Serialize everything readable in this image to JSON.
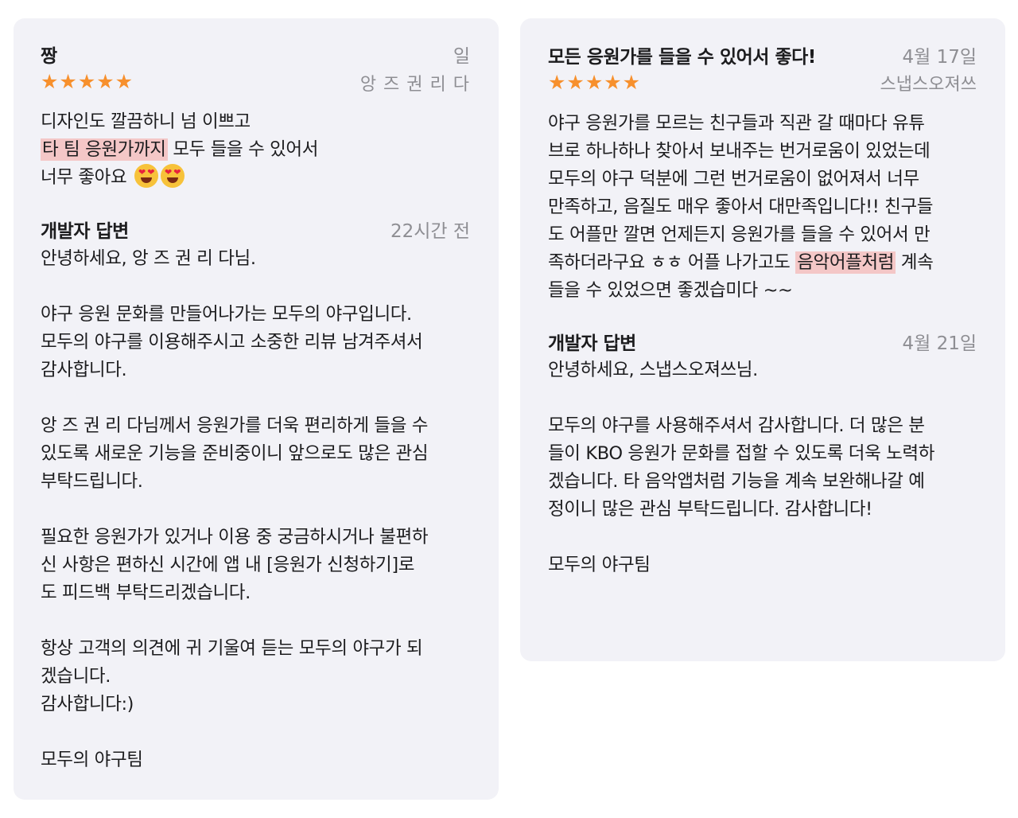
{
  "reviews": [
    {
      "title": "짱",
      "date": "일",
      "author": "앙 즈 권 리 다",
      "stars": "★★★★★",
      "body": {
        "l1": "디자인도 깔끔하니 넘 이쁘고",
        "l2_hl": "타 팀 응원가까지",
        "l2_rest": " 모두 들을 수 있어서",
        "l3": "너무 좋아요 "
      },
      "developer_response": {
        "label": "개발자 답변",
        "date": "22시간 전",
        "lines": [
          "안녕하세요, 앙 즈 권 리 다님.",
          "",
          "야구 응원 문화를 만들어나가는 모두의 야구입니다.",
          "모두의 야구를 이용해주시고 소중한 리뷰 남겨주셔서",
          "감사합니다.",
          "",
          "앙 즈 권 리 다님께서 응원가를 더욱 편리하게 들을 수",
          "있도록 새로운 기능을 준비중이니 앞으로도 많은 관심",
          "부탁드립니다.",
          "",
          "필요한 응원가가 있거나 이용 중 궁금하시거나 불편하",
          "신 사항은 편하신 시간에 앱 내 [응원가 신청하기]로",
          "도 피드백 부탁드리겠습니다.",
          "",
          "항상 고객의 의견에 귀 기울여 듣는 모두의 야구가 되",
          "겠습니다.",
          "감사합니다:)",
          "",
          "모두의 야구팀"
        ]
      }
    },
    {
      "title": "모든 응원가를 들을 수 있어서 좋다!",
      "date": "4월 17일",
      "author": "스냅스오져쓰",
      "stars": "★★★★★",
      "body": {
        "l1": "야구 응원가를 모르는 친구들과 직관 갈 때마다 유튜",
        "l2": "브로 하나하나 찾아서 보내주는 번거로움이 있었는데",
        "l3": "모두의 야구 덕분에 그런 번거로움이 없어져서 너무",
        "l4": "만족하고, 음질도 매우 좋아서 대만족입니다!! 친구들",
        "l5": "도 어플만 깔면 언제든지 응원가를 들을 수 있어서 만",
        "l6_pre": "족하더라구요 ㅎㅎ 어플 나가고도 ",
        "l6_hl": "음악어플처럼",
        "l6_post": " 계속",
        "l7": "들을 수 있었으면 좋겠습미다 ~~"
      },
      "developer_response": {
        "label": "개발자 답변",
        "date": "4월 21일",
        "lines": [
          "안녕하세요, 스냅스오져쓰님.",
          "",
          "모두의 야구를 사용해주셔서 감사합니다. 더 많은 분",
          "들이 KBO 응원가 문화를 접할 수 있도록 더욱 노력하",
          "겠습니다. 타 음악앱처럼 기능을 계속 보완해나갈 예",
          "정이니 많은 관심 부탁드립니다. 감사합니다!",
          "",
          "모두의 야구팀"
        ]
      }
    }
  ],
  "colors": {
    "card_bg": "#f2f2f7",
    "star": "#f7902d",
    "highlight": "#f4c7c7",
    "secondary_text": "#8e8e93"
  },
  "icons": [
    "star-icon",
    "heart-eyes-emoji-icon"
  ]
}
